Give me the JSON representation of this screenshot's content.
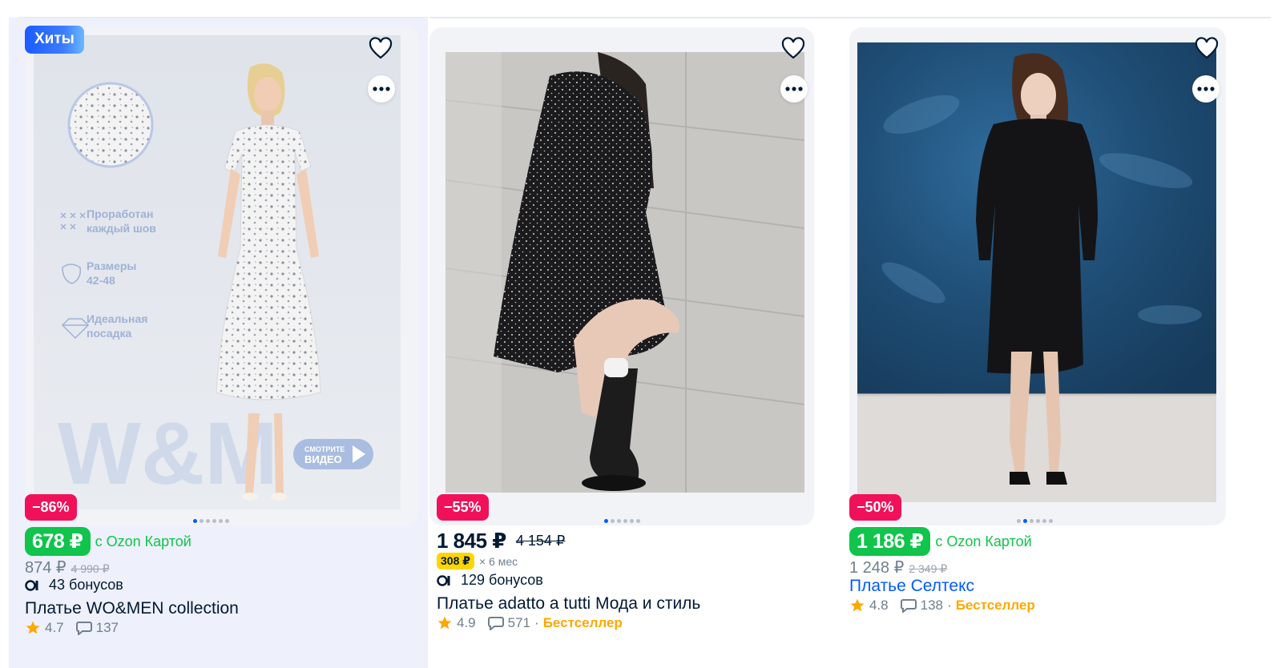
{
  "products": [
    {
      "badge": "Хиты",
      "discount": "−86%",
      "ozon_card_price": "678 ₽",
      "ozon_card_label": "с Ozon Картой",
      "price": "874 ₽",
      "old_price": "4 990 ₽",
      "bonus": "43 бонусов",
      "title": "Платье WO&MEN collection",
      "rating": "4.7",
      "reviews": "137",
      "photo_texts": {
        "feature_1_line_1": "Проработан",
        "feature_1_line_2": "каждый шов",
        "feature_2_line_1": "Размеры",
        "feature_2_line_2": "42-48",
        "feature_3_line_1": "Идеальная",
        "feature_3_line_2": "посадка",
        "watermark": "W&M",
        "video_line_1": "СМОТРИТЕ",
        "video_line_2": "ВИДЕО"
      },
      "image_count": 6,
      "active_image": 0
    },
    {
      "discount": "−55%",
      "price": "1 845 ₽",
      "old_price": "4 154 ₽",
      "installment_amount": "308 ₽",
      "installment_term": "× 6 мес",
      "bonus": "129 бонусов",
      "title": "Платье adatto a tutti Мода и стиль",
      "rating": "4.9",
      "reviews": "571",
      "separator": "·",
      "bestseller": "Бестселлер",
      "image_count": 6,
      "active_image": 0
    },
    {
      "discount": "−50%",
      "ozon_card_price": "1 186 ₽",
      "ozon_card_label": "с Ozon Картой",
      "price": "1 248 ₽",
      "old_price": "2 349 ₽",
      "title": "Платье Селтекс",
      "rating": "4.8",
      "reviews": "138",
      "separator": "·",
      "bestseller": "Бестселлер",
      "image_count": 6,
      "active_image": 1
    }
  ],
  "colors": {
    "accent_blue": "#005bff",
    "ozon_card_green": "#10c44c",
    "discount_red": "#f1115a",
    "bestseller_orange": "#ffa800",
    "installment_yellow": "#ffd500"
  }
}
